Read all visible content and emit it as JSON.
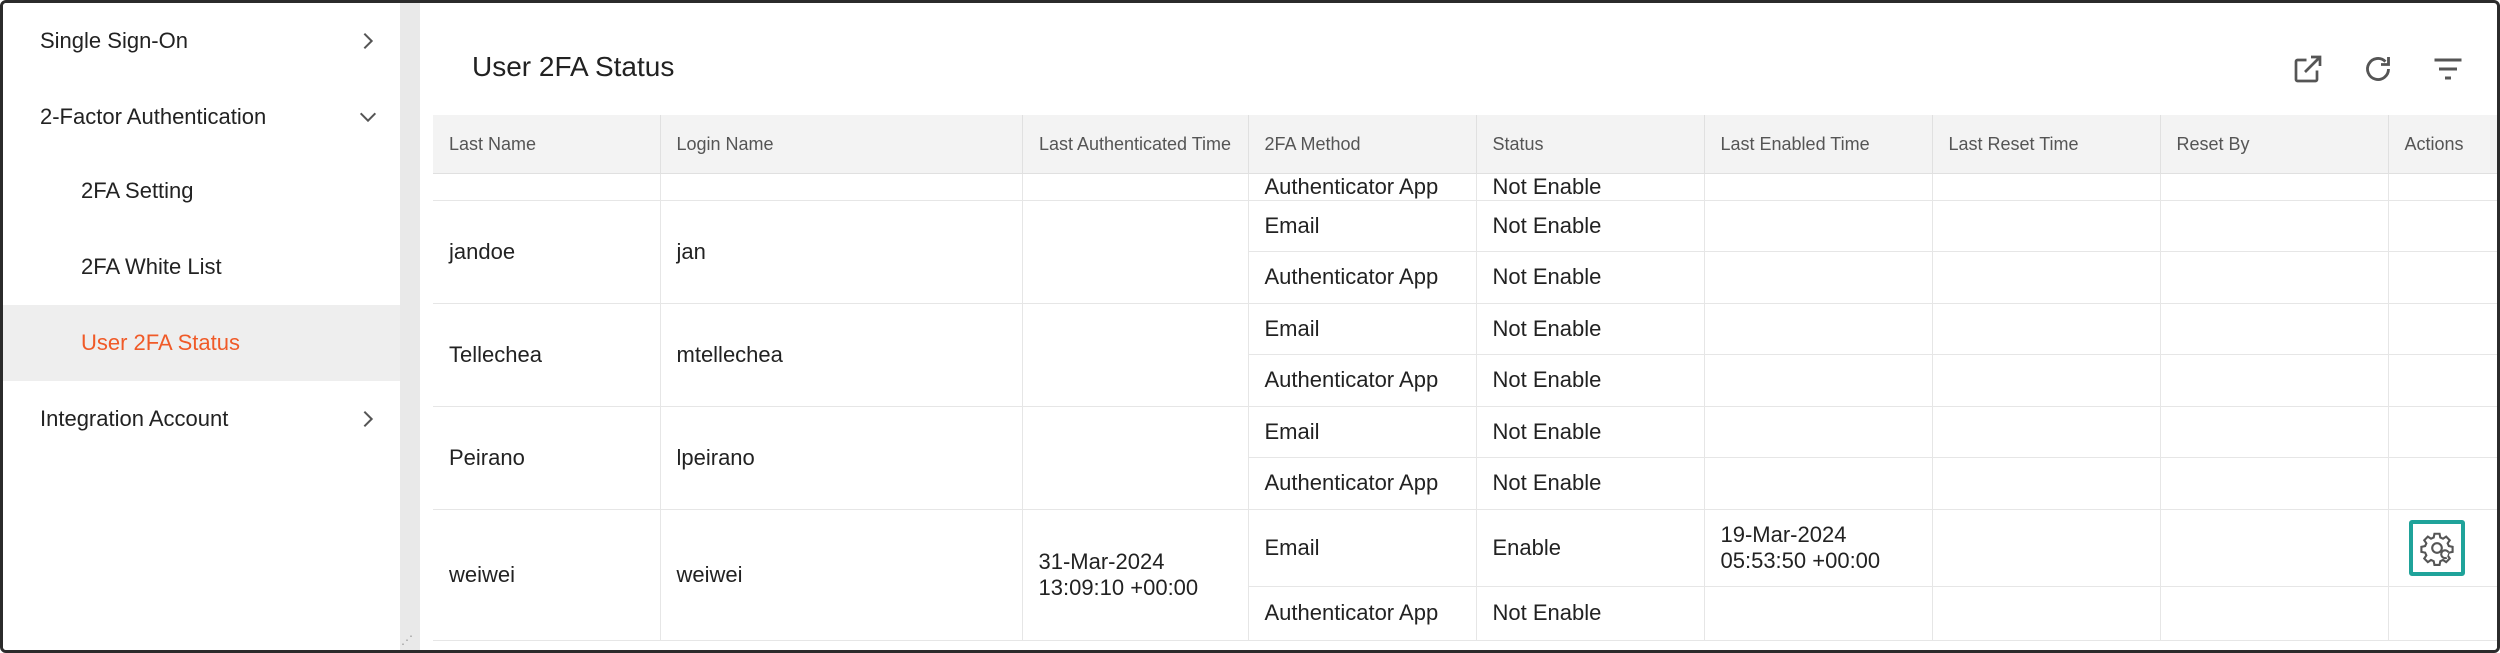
{
  "sidebar": {
    "items": [
      {
        "label": "Single Sign-On",
        "chevron": "right"
      },
      {
        "label": "2-Factor Authentication",
        "chevron": "down"
      },
      {
        "label": "2FA Setting"
      },
      {
        "label": "2FA White List"
      },
      {
        "label": "User 2FA Status",
        "active": true
      },
      {
        "label": "Integration Account",
        "chevron": "right"
      }
    ]
  },
  "main": {
    "title": "User 2FA Status",
    "toolbar_icons": [
      "open-in-new-icon",
      "refresh-icon",
      "filter-icon"
    ]
  },
  "table": {
    "columns": [
      "Last Name",
      "Login Name",
      "Last Authenticated Time",
      "2FA Method",
      "Status",
      "Last Enabled Time",
      "Last Reset Time",
      "Reset By",
      "Actions"
    ],
    "clipped_row": {
      "method": "Authenticator App",
      "status": "Not Enable"
    },
    "users": [
      {
        "last_name": "jandoe",
        "login": "jan",
        "last_auth": "",
        "methods": [
          {
            "method": "Email",
            "status": "Not Enable",
            "last_enabled": "",
            "last_reset": "",
            "reset_by": ""
          },
          {
            "method": "Authenticator App",
            "status": "Not Enable",
            "last_enabled": "",
            "last_reset": "",
            "reset_by": ""
          }
        ]
      },
      {
        "last_name": "Tellechea",
        "login": "mtellechea",
        "last_auth": "",
        "methods": [
          {
            "method": "Email",
            "status": "Not Enable",
            "last_enabled": "",
            "last_reset": "",
            "reset_by": ""
          },
          {
            "method": "Authenticator App",
            "status": "Not Enable",
            "last_enabled": "",
            "last_reset": "",
            "reset_by": ""
          }
        ]
      },
      {
        "last_name": "Peirano",
        "login": "lpeirano",
        "last_auth": "",
        "methods": [
          {
            "method": "Email",
            "status": "Not Enable",
            "last_enabled": "",
            "last_reset": "",
            "reset_by": ""
          },
          {
            "method": "Authenticator App",
            "status": "Not Enable",
            "last_enabled": "",
            "last_reset": "",
            "reset_by": ""
          }
        ]
      },
      {
        "last_name": "weiwei",
        "login": "weiwei",
        "last_auth": "31-Mar-2024 13:09:10 +00:00",
        "methods": [
          {
            "method": "Email",
            "status": "Enable",
            "last_enabled": "19-Mar-2024 05:53:50 +00:00",
            "last_reset": "",
            "reset_by": "",
            "action": "reset-gear-icon"
          },
          {
            "method": "Authenticator App",
            "status": "Not Enable",
            "last_enabled": "",
            "last_reset": "",
            "reset_by": ""
          }
        ]
      }
    ]
  },
  "colors": {
    "accent": "#f05a28",
    "highlight_box": "#1fa39a",
    "header_bg": "#f3f3f3",
    "active_bg": "#eeeeee"
  }
}
